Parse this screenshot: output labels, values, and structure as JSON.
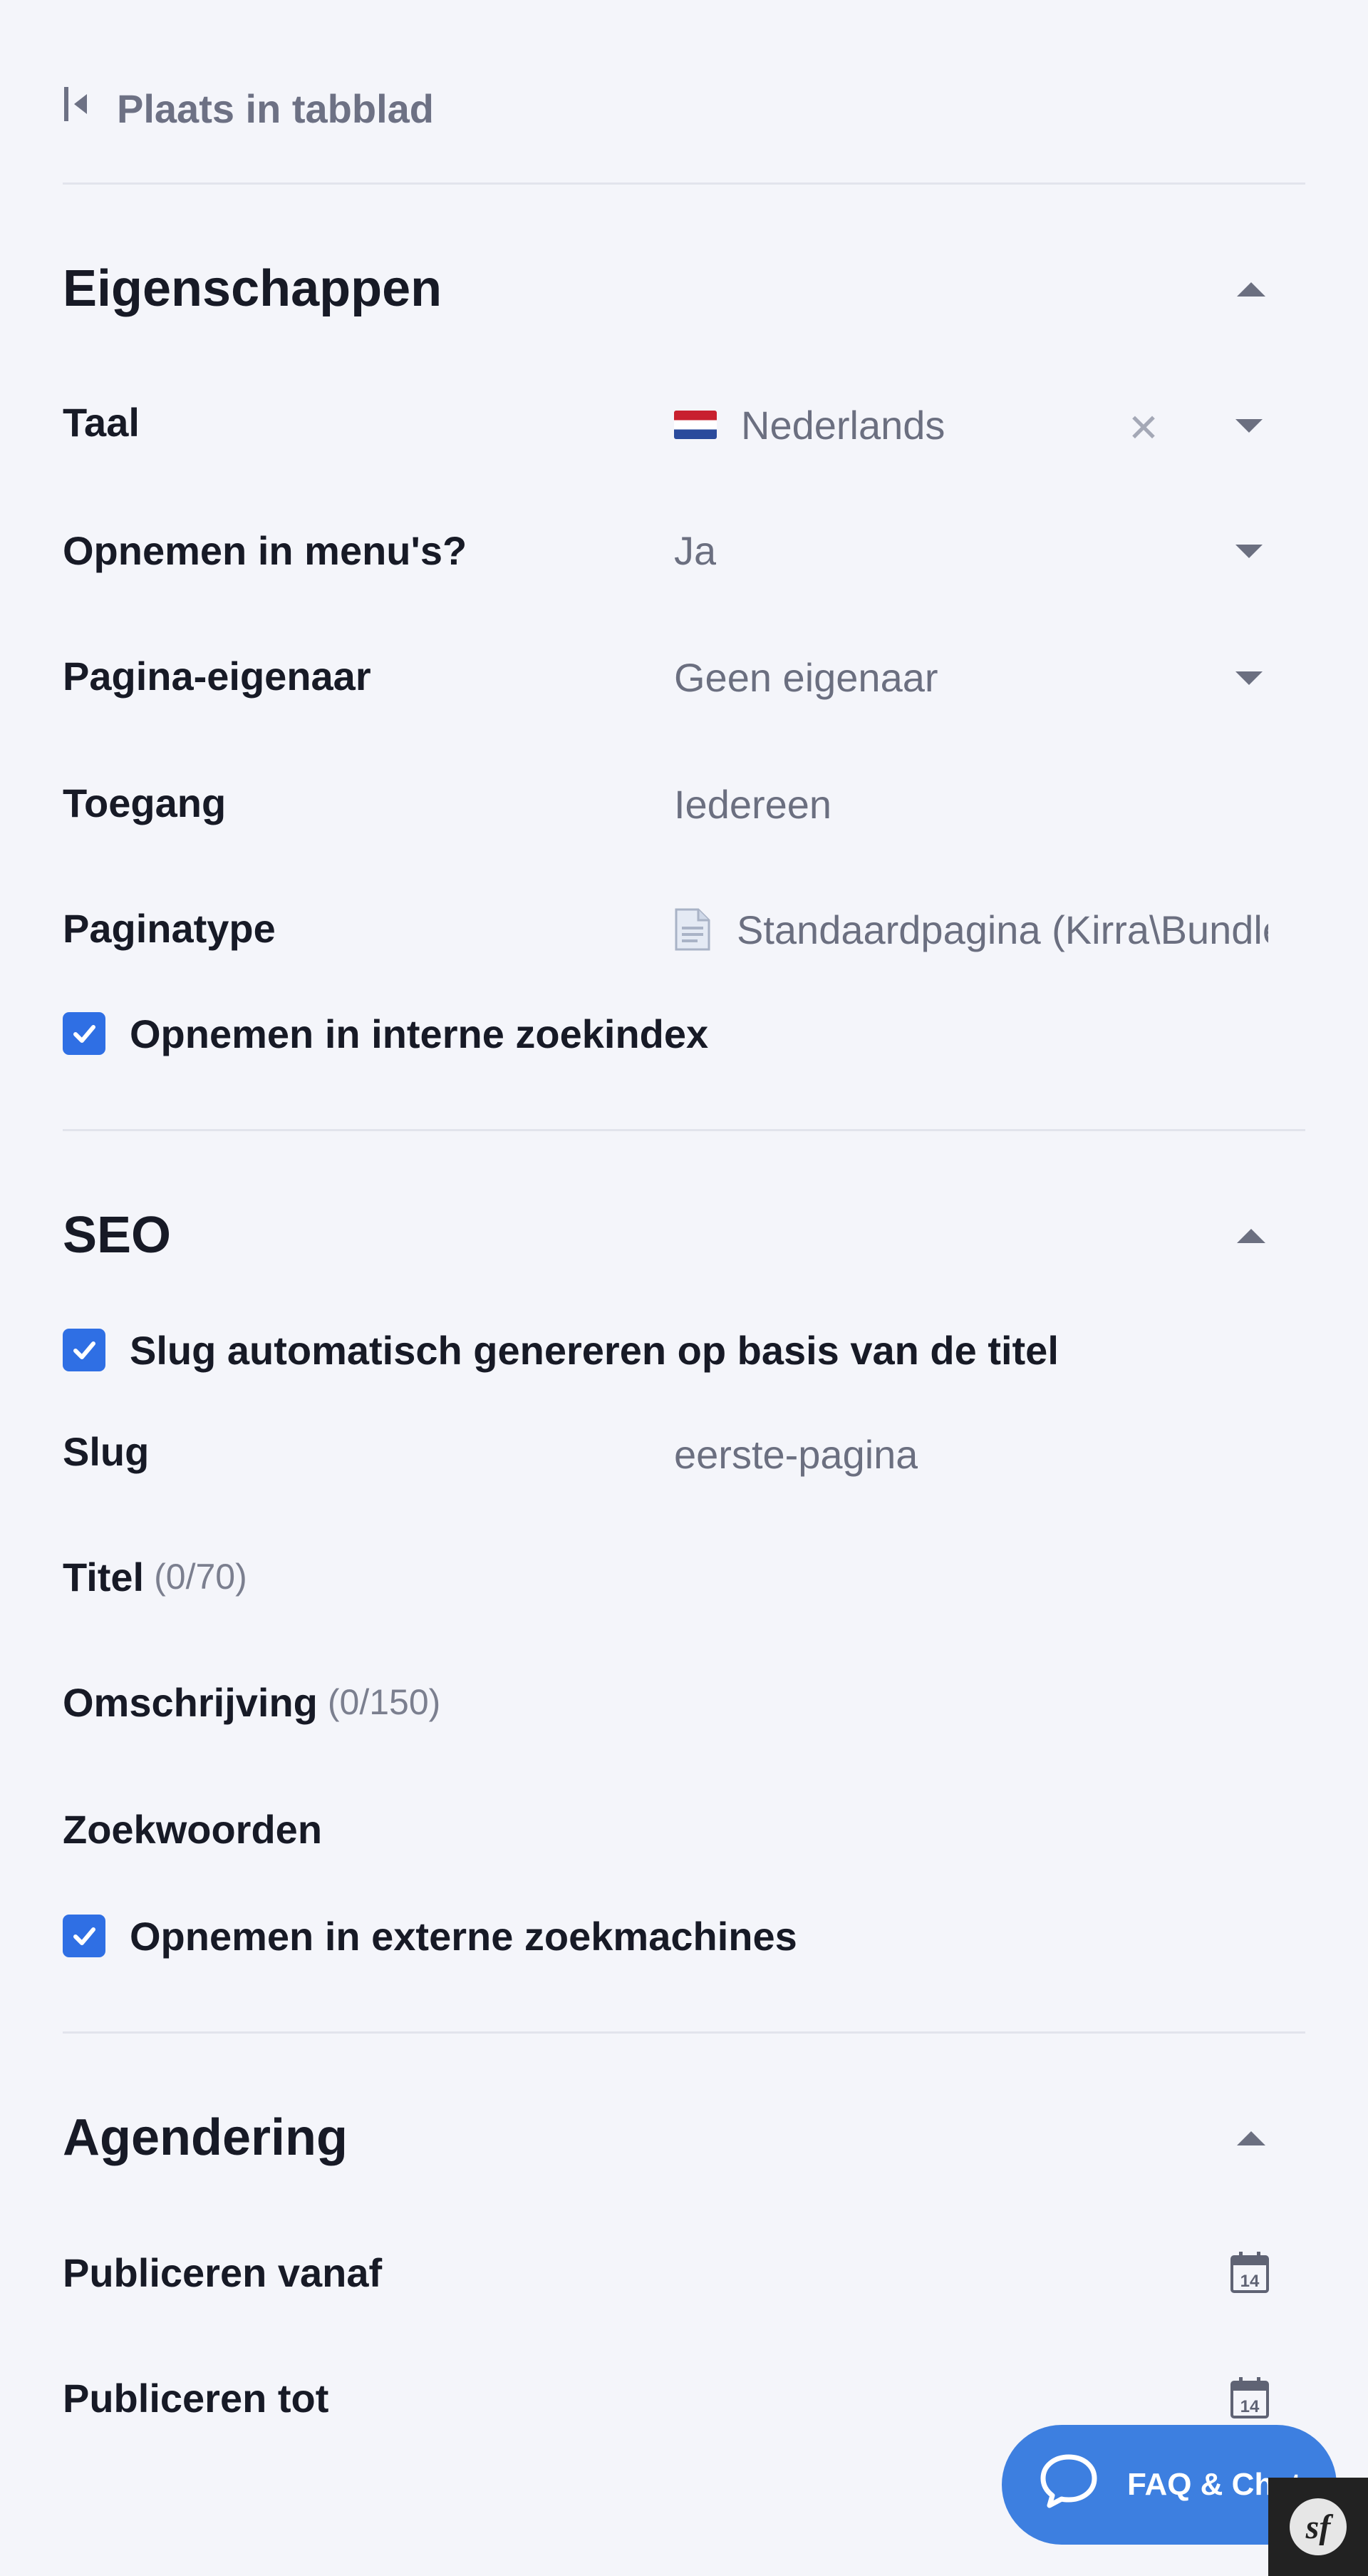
{
  "top_link": {
    "label": "Plaats in tabblad",
    "icon": "collapse-to-tab-icon"
  },
  "properties": {
    "title": "Eigenschappen",
    "language": {
      "label": "Taal",
      "value": "Nederlands",
      "flag": "dutch-flag"
    },
    "in_menus": {
      "label": "Opnemen in menu's?",
      "value": "Ja"
    },
    "page_owner": {
      "label": "Pagina-eigenaar",
      "value": "Geen eigenaar"
    },
    "access": {
      "label": "Toegang",
      "value": "Iedereen"
    },
    "page_type": {
      "label": "Paginatype",
      "value": "Standaardpagina (Kirra\\Bundle"
    },
    "internal_index": {
      "label": "Opnemen in interne zoekindex",
      "checked": true
    }
  },
  "seo": {
    "title": "SEO",
    "auto_slug": {
      "label": "Slug automatisch genereren op basis van de titel",
      "checked": true
    },
    "slug": {
      "label": "Slug",
      "value": "eerste-pagina"
    },
    "meta_title": {
      "label": "Titel",
      "counter": "(0/70)"
    },
    "description": {
      "label": "Omschrijving",
      "counter": "(0/150)"
    },
    "keywords": {
      "label": "Zoekwoorden"
    },
    "external_index": {
      "label": "Opnemen in externe zoekmachines",
      "checked": true
    }
  },
  "scheduling": {
    "title": "Agendering",
    "publish_from": {
      "label": "Publiceren vanaf",
      "calendar_day": "14"
    },
    "publish_until": {
      "label": "Publiceren tot",
      "calendar_day": "14"
    }
  },
  "chat": {
    "label": "FAQ & Chat"
  },
  "colors": {
    "accent": "#2f6fe4",
    "chat": "#3d7fe0",
    "background": "#f4f5fa"
  }
}
